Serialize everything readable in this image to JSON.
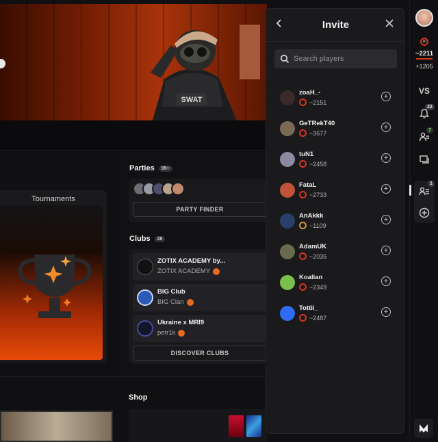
{
  "invite": {
    "title": "Invite",
    "search_placeholder": "Search players",
    "players": [
      {
        "name": "zoaH_-",
        "elo": "~2151",
        "avatar_color": "#3b2a2a"
      },
      {
        "name": "GeTRekT40",
        "elo": "~3677",
        "avatar_color": "#7a6a55"
      },
      {
        "name": "tuN1",
        "elo": "~2458",
        "avatar_color": "#8a8aa0"
      },
      {
        "name": "FataL",
        "elo": "~2733",
        "avatar_color": "#c0533a"
      },
      {
        "name": "AnAkkk",
        "elo": "~1109",
        "avatar_color": "#2a3e6a"
      },
      {
        "name": "AdamUK",
        "elo": "~2035",
        "avatar_color": "#6a6a4e"
      },
      {
        "name": "Koalian",
        "elo": "~2349",
        "avatar_color": "#7ac04a"
      },
      {
        "name": "Tottii_",
        "elo": "~2487",
        "avatar_color": "#2f6cf0"
      }
    ]
  },
  "main": {
    "tournaments_label": "Tournaments",
    "parties": {
      "title": "Parties",
      "count": "99+",
      "button": "PARTY FINDER"
    },
    "clubs": {
      "title": "Clubs",
      "count": "28",
      "items": [
        {
          "name": "ZOTIX ACADEMY by...",
          "sub": "ZOTIX ACADEMY"
        },
        {
          "name": "BIG Club",
          "sub": "BIG Clan"
        },
        {
          "name": "Ukraine x MRI9",
          "sub": "petr1k"
        }
      ],
      "button": "DISCOVER CLUBS"
    },
    "shop_title": "Shop"
  },
  "rail": {
    "level": "10",
    "elo": "~2211",
    "elo_diff": "+1205",
    "vs_label": "VS",
    "notifications_count": "22",
    "friends_count": "7",
    "party_count": "1"
  },
  "colors": {
    "accent": "#e8560f",
    "elo_red": "#d8341e",
    "panel_bg": "#1a1a1d"
  }
}
